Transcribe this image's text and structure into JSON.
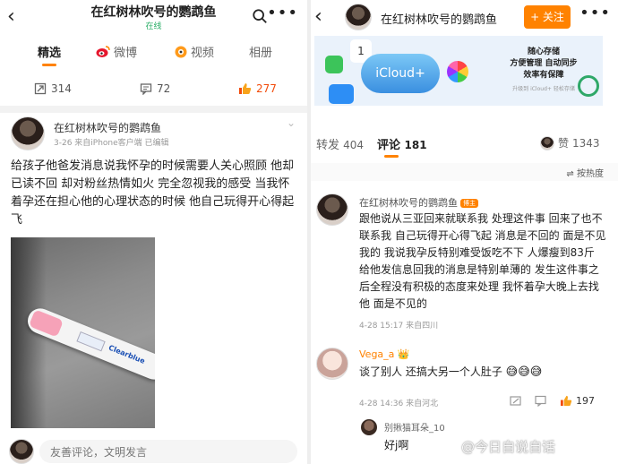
{
  "left": {
    "header": {
      "back_icon": "chevron-left-icon",
      "title": "在红树林吹号的鹦鹉鱼",
      "status": "在线",
      "search_icon": "search-icon",
      "more_icon": "more-icon"
    },
    "tabs": [
      {
        "label": "精选",
        "active": true
      },
      {
        "label": "微博",
        "icon": "weibo-icon"
      },
      {
        "label": "视频",
        "icon": "video-icon"
      },
      {
        "label": "相册"
      }
    ],
    "stats": {
      "repost": "314",
      "comment": "72",
      "like": "277"
    },
    "post": {
      "author": "在红树林吹号的鹦鹉鱼",
      "meta": "3-26  来自iPhone客户端  已编辑",
      "text": "给孩子他爸发消息说我怀孕的时候需要人关心照顾 他却已读不回 却对粉丝热情如火 完全忽视我的感受 当我怀着孕还在担心他的心理状态的时候 他自己玩得开心得起飞",
      "image_brand": "Clearblue"
    },
    "bottom": {
      "comment_placeholder": "友善评论，文明发言"
    }
  },
  "right": {
    "header": {
      "title": "在红树林吹号的鹦鹉鱼",
      "follow_label": "+ 关注",
      "more_icon": "more-icon"
    },
    "banner": {
      "calendar_day": "1",
      "cloud_label": "iCloud+",
      "text": "随心存储\n方便管理 自动同步\n效率有保障",
      "small": "升级到 iCloud+ 轻松存储"
    },
    "tabs": {
      "repost_label": "转发",
      "repost_count": "404",
      "comment_label": "评论",
      "comment_count": "181",
      "like_label": "赞",
      "like_count": "1343"
    },
    "sort_label": "按热度",
    "comments": [
      {
        "author": "在红树林吹号的鹦鹉鱼",
        "badge": "博主",
        "text": "跟他说从三亚回来就联系我 处理这件事 回来了也不联系我 自己玩得开心得飞起 消息是不回的 面是不见我的 我说我孕反特别难受饭吃不下 人爆瘦到83斤 给他发信息回我的消息是特别单薄的 发生这件事之后全程没有积极的态度来处理 我怀着孕大晚上去找他 面是不见的",
        "meta": "4-28 15:17  来自四川"
      },
      {
        "author": "Vega_a",
        "text": "谈了别人 还搞大另一个人肚子",
        "emoji": "😅😅😅",
        "meta": "4-28 14:36  来自河北",
        "like_count": "197"
      }
    ],
    "sub_reply": {
      "author": "别揪猫耳朵_10",
      "text": "好j啊"
    }
  },
  "watermark": "@今日自说自话"
}
